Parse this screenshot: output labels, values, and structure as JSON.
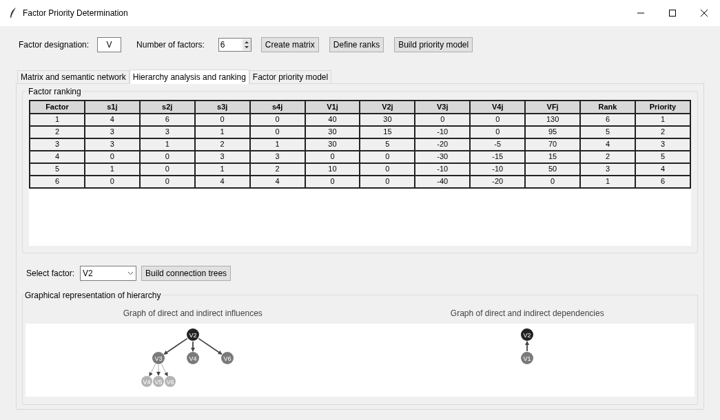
{
  "window": {
    "title": "Factor Priority Determination"
  },
  "toolbar": {
    "designation_label": "Factor designation:",
    "designation_value": "V",
    "count_label": "Number of factors:",
    "count_value": "6",
    "buttons": [
      "Create matrix",
      "Define ranks",
      "Build priority model"
    ]
  },
  "tabs": [
    {
      "label": "Matrix and semantic network",
      "selected": false
    },
    {
      "label": "Hierarchy analysis and ranking",
      "selected": true
    },
    {
      "label": "Factor priority model",
      "selected": false
    }
  ],
  "ranking": {
    "title": "Factor ranking",
    "columns": [
      "Factor",
      "s1j",
      "s2j",
      "s3j",
      "s4j",
      "V1j",
      "V2j",
      "V3j",
      "V4j",
      "VFj",
      "Rank",
      "Priority"
    ],
    "rows": [
      [
        "1",
        "4",
        "6",
        "0",
        "0",
        "40",
        "30",
        "0",
        "0",
        "130",
        "6",
        "1"
      ],
      [
        "2",
        "3",
        "3",
        "1",
        "0",
        "30",
        "15",
        "-10",
        "0",
        "95",
        "5",
        "2"
      ],
      [
        "3",
        "3",
        "1",
        "2",
        "1",
        "30",
        "5",
        "-20",
        "-5",
        "70",
        "4",
        "3"
      ],
      [
        "4",
        "0",
        "0",
        "3",
        "3",
        "0",
        "0",
        "-30",
        "-15",
        "15",
        "2",
        "5"
      ],
      [
        "5",
        "1",
        "0",
        "1",
        "2",
        "10",
        "0",
        "-10",
        "-10",
        "50",
        "3",
        "4"
      ],
      [
        "6",
        "0",
        "0",
        "4",
        "4",
        "0",
        "0",
        "-40",
        "-20",
        "0",
        "1",
        "6"
      ]
    ]
  },
  "select_factor": {
    "label": "Select factor:",
    "value": "V2",
    "button": "Build connection trees"
  },
  "hierarchy": {
    "title": "Graphical representation of hierarchy",
    "graphs": [
      {
        "title": "Graph of direct and indirect influences",
        "kind": "influences",
        "root": {
          "label": "V2",
          "children": [
            {
              "label": "V3",
              "children": [
                {
                  "label": "V4"
                },
                {
                  "label": "V5"
                },
                {
                  "label": "V6"
                }
              ]
            },
            {
              "label": "V4"
            },
            {
              "label": "V6"
            }
          ]
        }
      },
      {
        "title": "Graph of direct and indirect dependencies",
        "kind": "dependencies",
        "root": {
          "label": "V2",
          "children": [
            {
              "label": "V1"
            }
          ]
        }
      }
    ]
  }
}
